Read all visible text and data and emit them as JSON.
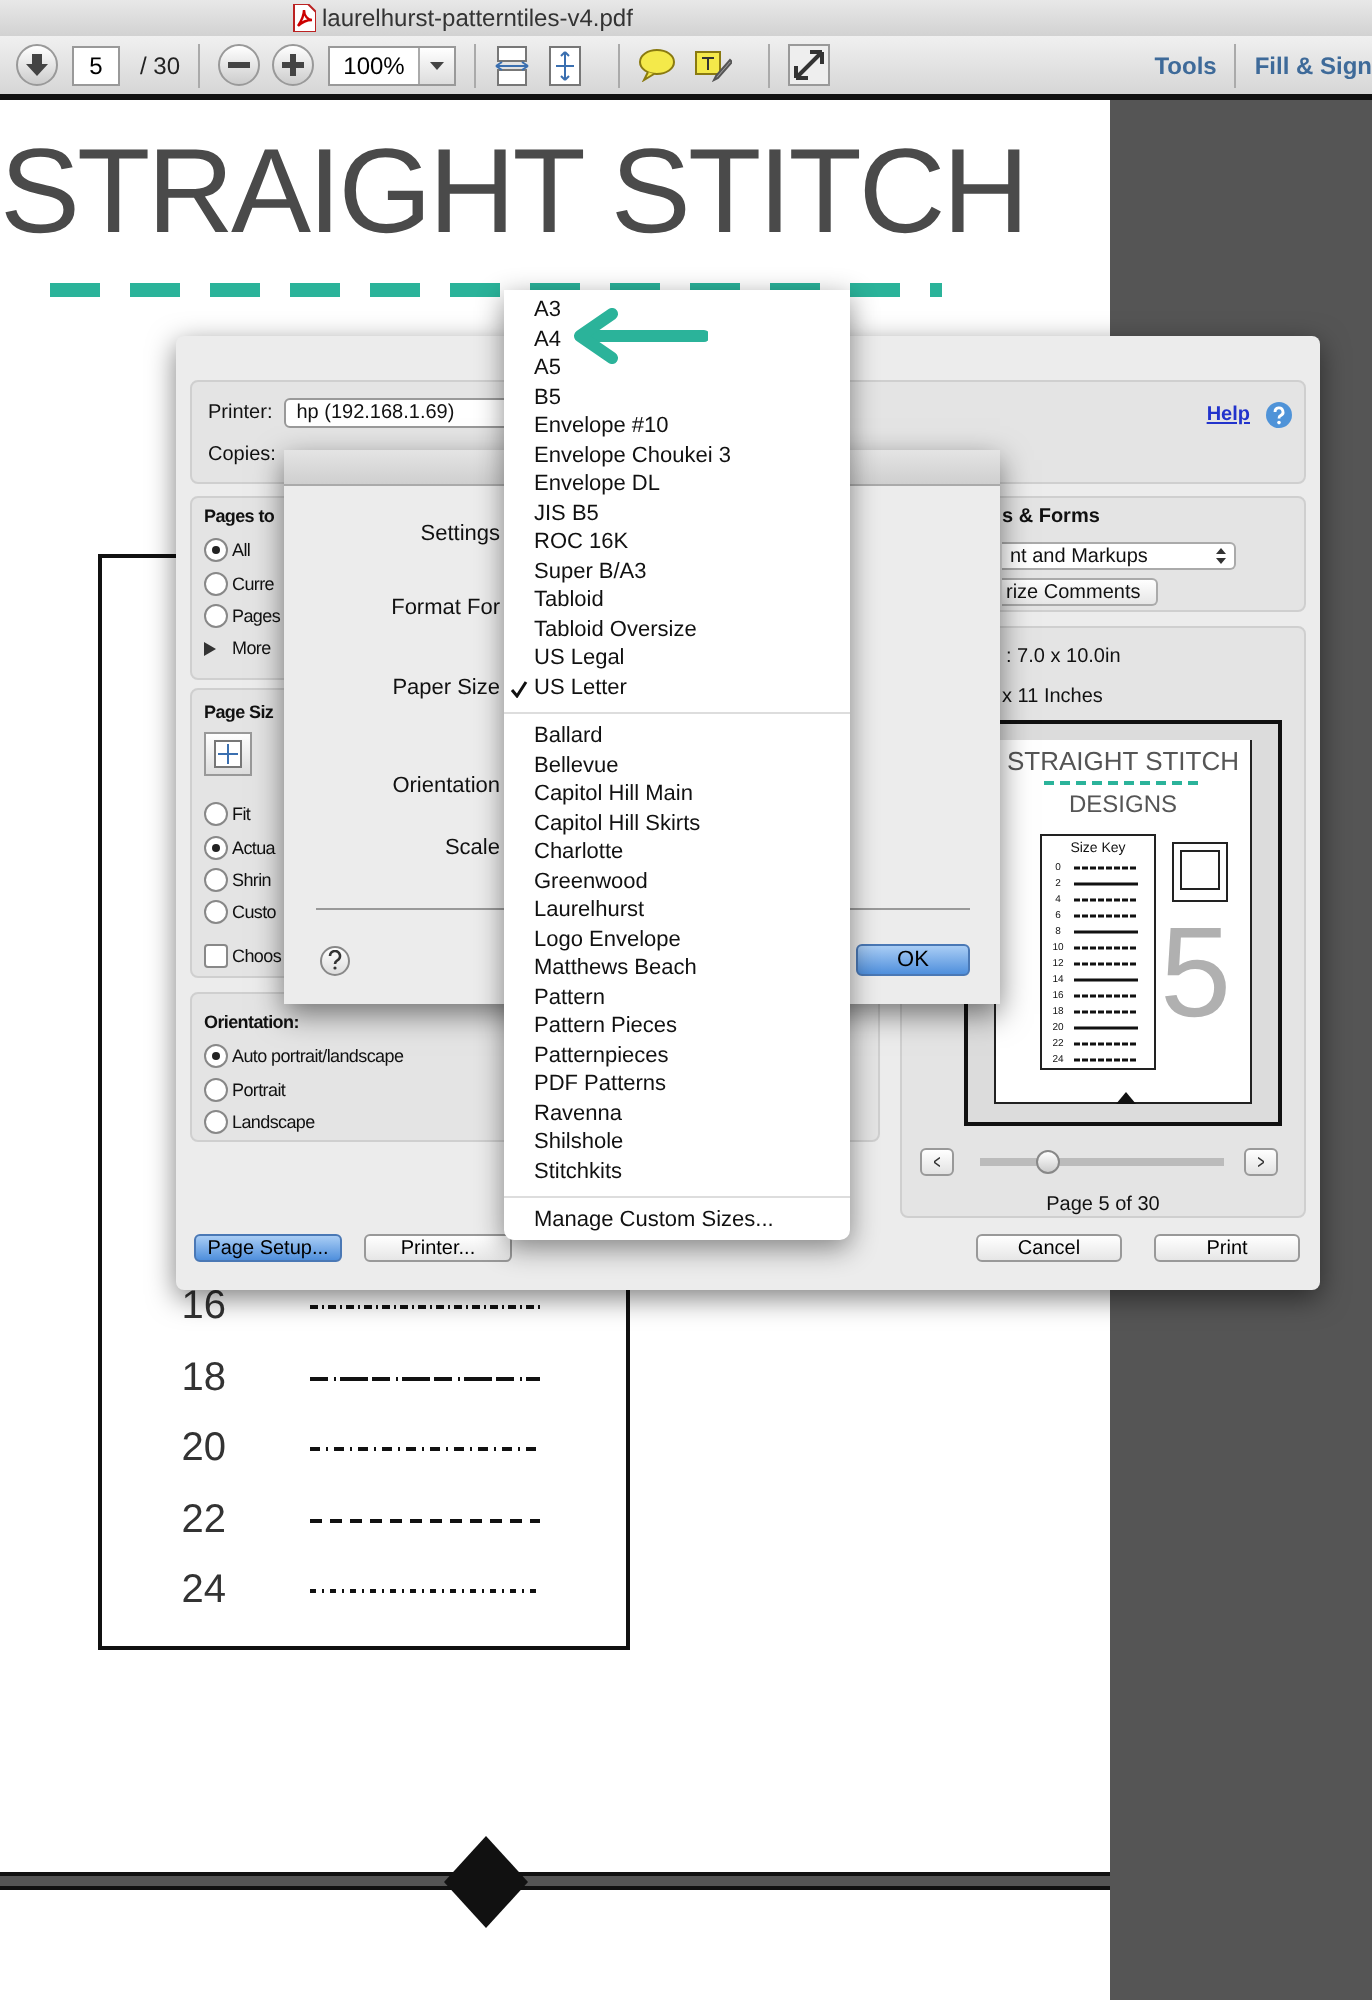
{
  "window": {
    "title": "laurelhurst-patterntiles-v4.pdf"
  },
  "toolbar": {
    "page": "5",
    "page_count": "/ 30",
    "zoom": "100%",
    "links": [
      "Tools",
      "Fill & Sign"
    ]
  },
  "document": {
    "heading": "STRAIGHT STITCH",
    "size_key": [
      "16",
      "18",
      "20",
      "22",
      "24"
    ]
  },
  "print_dialog": {
    "printer_label": "Printer:",
    "printer": "hp (192.168.1.69)",
    "copies_label": "Copies:",
    "help": "Help",
    "pages": {
      "title": "Pages to",
      "options": [
        {
          "label": "All",
          "selected": true
        },
        {
          "label": "Curre",
          "selected": false
        },
        {
          "label": "Pages",
          "selected": false
        }
      ],
      "more": "More"
    },
    "page_size": {
      "title": "Page Siz",
      "options": [
        {
          "label": "Fit",
          "selected": false
        },
        {
          "label": "Actua",
          "selected": true
        },
        {
          "label": "Shrin",
          "selected": false
        },
        {
          "label": "Custo",
          "selected": false
        }
      ],
      "checkbox": {
        "label": "Choos",
        "checked": false
      }
    },
    "orientation": {
      "title": "Orientation:",
      "options": [
        {
          "label": "Auto portrait/landscape",
          "selected": true
        },
        {
          "label": "Portrait",
          "selected": false
        },
        {
          "label": "Landscape",
          "selected": false
        }
      ]
    },
    "comments": {
      "title": "s & Forms",
      "popup": "nt and Markups",
      "button": "rize Comments"
    },
    "preview": {
      "scale": ": 7.0 x 10.0in",
      "paper": "x 11 Inches",
      "thumb_title": "STRAIGHT STITCH",
      "thumb_subtitle": "DESIGNS",
      "thumb_key_title": "Size Key",
      "thumb_key_sizes": [
        "0",
        "2",
        "4",
        "6",
        "8",
        "10",
        "12",
        "14",
        "16",
        "18",
        "20",
        "22",
        "24"
      ],
      "thumb_page": "5",
      "slider": {
        "level": 0.28
      },
      "page_label": "Page 5 of 30"
    },
    "left_buttons": [
      {
        "label": "Page Setup...",
        "default": true
      },
      {
        "label": "Printer...",
        "default": false
      }
    ],
    "right_buttons": [
      {
        "label": "Cancel",
        "default": false
      },
      {
        "label": "Print",
        "default": false
      }
    ]
  },
  "page_setup": {
    "labels": [
      "Settings",
      "Format For",
      "Paper Size",
      "Orientation",
      "Scale"
    ],
    "ok": {
      "label": "OK",
      "default": true
    }
  },
  "paper_menu": {
    "groups": [
      [
        {
          "label": "A3",
          "checked": false
        },
        {
          "label": "A4",
          "checked": false
        },
        {
          "label": "A5",
          "checked": false
        },
        {
          "label": "B5",
          "checked": false
        },
        {
          "label": "Envelope #10",
          "checked": false
        },
        {
          "label": "Envelope Choukei 3",
          "checked": false
        },
        {
          "label": "Envelope DL",
          "checked": false
        },
        {
          "label": "JIS B5",
          "checked": false
        },
        {
          "label": "ROC 16K",
          "checked": false
        },
        {
          "label": "Super B/A3",
          "checked": false
        },
        {
          "label": "Tabloid",
          "checked": false
        },
        {
          "label": "Tabloid Oversize",
          "checked": false
        },
        {
          "label": "US Legal",
          "checked": false
        },
        {
          "label": "US Letter",
          "checked": true
        }
      ],
      [
        {
          "label": "Ballard",
          "checked": false
        },
        {
          "label": "Bellevue",
          "checked": false
        },
        {
          "label": "Capitol Hill Main",
          "checked": false
        },
        {
          "label": "Capitol Hill Skirts",
          "checked": false
        },
        {
          "label": "Charlotte",
          "checked": false
        },
        {
          "label": "Greenwood",
          "checked": false
        },
        {
          "label": "Laurelhurst",
          "checked": false
        },
        {
          "label": "Logo Envelope",
          "checked": false
        },
        {
          "label": "Matthews Beach",
          "checked": false
        },
        {
          "label": "Pattern",
          "checked": false
        },
        {
          "label": "Pattern Pieces",
          "checked": false
        },
        {
          "label": "Patternpieces",
          "checked": false
        },
        {
          "label": "PDF Patterns",
          "checked": false
        },
        {
          "label": "Ravenna",
          "checked": false
        },
        {
          "label": "Shilshole",
          "checked": false
        },
        {
          "label": "Stitchkits",
          "checked": false
        }
      ],
      [
        {
          "label": "Manage Custom Sizes...",
          "checked": false
        }
      ]
    ]
  }
}
